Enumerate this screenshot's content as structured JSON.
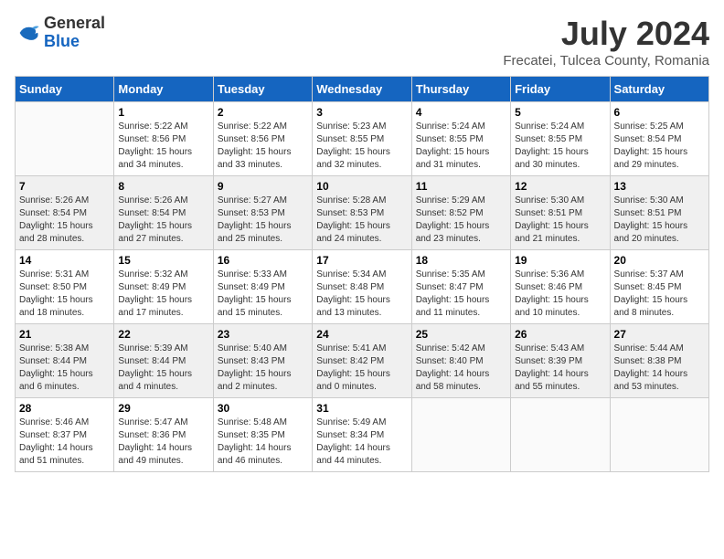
{
  "header": {
    "logo_line1": "General",
    "logo_line2": "Blue",
    "month": "July 2024",
    "location": "Frecatei, Tulcea County, Romania"
  },
  "days_of_week": [
    "Sunday",
    "Monday",
    "Tuesday",
    "Wednesday",
    "Thursday",
    "Friday",
    "Saturday"
  ],
  "weeks": [
    [
      {
        "day": "",
        "info": ""
      },
      {
        "day": "1",
        "info": "Sunrise: 5:22 AM\nSunset: 8:56 PM\nDaylight: 15 hours\nand 34 minutes."
      },
      {
        "day": "2",
        "info": "Sunrise: 5:22 AM\nSunset: 8:56 PM\nDaylight: 15 hours\nand 33 minutes."
      },
      {
        "day": "3",
        "info": "Sunrise: 5:23 AM\nSunset: 8:55 PM\nDaylight: 15 hours\nand 32 minutes."
      },
      {
        "day": "4",
        "info": "Sunrise: 5:24 AM\nSunset: 8:55 PM\nDaylight: 15 hours\nand 31 minutes."
      },
      {
        "day": "5",
        "info": "Sunrise: 5:24 AM\nSunset: 8:55 PM\nDaylight: 15 hours\nand 30 minutes."
      },
      {
        "day": "6",
        "info": "Sunrise: 5:25 AM\nSunset: 8:54 PM\nDaylight: 15 hours\nand 29 minutes."
      }
    ],
    [
      {
        "day": "7",
        "info": "Sunrise: 5:26 AM\nSunset: 8:54 PM\nDaylight: 15 hours\nand 28 minutes."
      },
      {
        "day": "8",
        "info": "Sunrise: 5:26 AM\nSunset: 8:54 PM\nDaylight: 15 hours\nand 27 minutes."
      },
      {
        "day": "9",
        "info": "Sunrise: 5:27 AM\nSunset: 8:53 PM\nDaylight: 15 hours\nand 25 minutes."
      },
      {
        "day": "10",
        "info": "Sunrise: 5:28 AM\nSunset: 8:53 PM\nDaylight: 15 hours\nand 24 minutes."
      },
      {
        "day": "11",
        "info": "Sunrise: 5:29 AM\nSunset: 8:52 PM\nDaylight: 15 hours\nand 23 minutes."
      },
      {
        "day": "12",
        "info": "Sunrise: 5:30 AM\nSunset: 8:51 PM\nDaylight: 15 hours\nand 21 minutes."
      },
      {
        "day": "13",
        "info": "Sunrise: 5:30 AM\nSunset: 8:51 PM\nDaylight: 15 hours\nand 20 minutes."
      }
    ],
    [
      {
        "day": "14",
        "info": "Sunrise: 5:31 AM\nSunset: 8:50 PM\nDaylight: 15 hours\nand 18 minutes."
      },
      {
        "day": "15",
        "info": "Sunrise: 5:32 AM\nSunset: 8:49 PM\nDaylight: 15 hours\nand 17 minutes."
      },
      {
        "day": "16",
        "info": "Sunrise: 5:33 AM\nSunset: 8:49 PM\nDaylight: 15 hours\nand 15 minutes."
      },
      {
        "day": "17",
        "info": "Sunrise: 5:34 AM\nSunset: 8:48 PM\nDaylight: 15 hours\nand 13 minutes."
      },
      {
        "day": "18",
        "info": "Sunrise: 5:35 AM\nSunset: 8:47 PM\nDaylight: 15 hours\nand 11 minutes."
      },
      {
        "day": "19",
        "info": "Sunrise: 5:36 AM\nSunset: 8:46 PM\nDaylight: 15 hours\nand 10 minutes."
      },
      {
        "day": "20",
        "info": "Sunrise: 5:37 AM\nSunset: 8:45 PM\nDaylight: 15 hours\nand 8 minutes."
      }
    ],
    [
      {
        "day": "21",
        "info": "Sunrise: 5:38 AM\nSunset: 8:44 PM\nDaylight: 15 hours\nand 6 minutes."
      },
      {
        "day": "22",
        "info": "Sunrise: 5:39 AM\nSunset: 8:44 PM\nDaylight: 15 hours\nand 4 minutes."
      },
      {
        "day": "23",
        "info": "Sunrise: 5:40 AM\nSunset: 8:43 PM\nDaylight: 15 hours\nand 2 minutes."
      },
      {
        "day": "24",
        "info": "Sunrise: 5:41 AM\nSunset: 8:42 PM\nDaylight: 15 hours\nand 0 minutes."
      },
      {
        "day": "25",
        "info": "Sunrise: 5:42 AM\nSunset: 8:40 PM\nDaylight: 14 hours\nand 58 minutes."
      },
      {
        "day": "26",
        "info": "Sunrise: 5:43 AM\nSunset: 8:39 PM\nDaylight: 14 hours\nand 55 minutes."
      },
      {
        "day": "27",
        "info": "Sunrise: 5:44 AM\nSunset: 8:38 PM\nDaylight: 14 hours\nand 53 minutes."
      }
    ],
    [
      {
        "day": "28",
        "info": "Sunrise: 5:46 AM\nSunset: 8:37 PM\nDaylight: 14 hours\nand 51 minutes."
      },
      {
        "day": "29",
        "info": "Sunrise: 5:47 AM\nSunset: 8:36 PM\nDaylight: 14 hours\nand 49 minutes."
      },
      {
        "day": "30",
        "info": "Sunrise: 5:48 AM\nSunset: 8:35 PM\nDaylight: 14 hours\nand 46 minutes."
      },
      {
        "day": "31",
        "info": "Sunrise: 5:49 AM\nSunset: 8:34 PM\nDaylight: 14 hours\nand 44 minutes."
      },
      {
        "day": "",
        "info": ""
      },
      {
        "day": "",
        "info": ""
      },
      {
        "day": "",
        "info": ""
      }
    ]
  ]
}
